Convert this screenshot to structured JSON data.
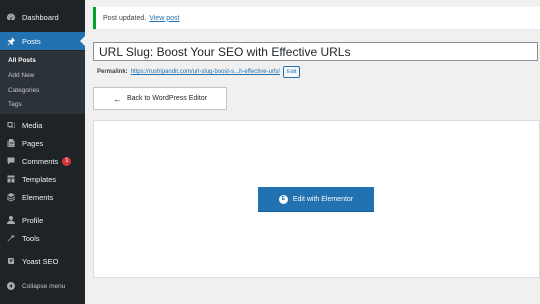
{
  "sidebar": {
    "items": [
      {
        "label": "Dashboard",
        "icon": "dashboard-icon"
      },
      {
        "label": "Posts",
        "icon": "pin-icon"
      },
      {
        "label": "Media",
        "icon": "media-icon"
      },
      {
        "label": "Pages",
        "icon": "pages-icon"
      },
      {
        "label": "Comments",
        "icon": "comments-icon",
        "badge": "1"
      },
      {
        "label": "Templates",
        "icon": "templates-icon"
      },
      {
        "label": "Elements",
        "icon": "elements-icon"
      },
      {
        "label": "Profile",
        "icon": "profile-icon"
      },
      {
        "label": "Tools",
        "icon": "tools-icon"
      },
      {
        "label": "Yoast SEO",
        "icon": "yoast-icon"
      },
      {
        "label": "Collapse menu",
        "icon": "collapse-icon"
      }
    ],
    "submenu": [
      "All Posts",
      "Add New",
      "Categories",
      "Tags"
    ]
  },
  "notice": {
    "text": "Post updated.",
    "link": "View post"
  },
  "post": {
    "title": "URL Slug: Boost Your SEO with Effective URLs"
  },
  "permalink": {
    "label": "Permalink:",
    "url": "https://rushipandit.com/url-slug-boost-s...h-effective-urls/",
    "edit": "Edit"
  },
  "back_button": {
    "label": "Back to WordPress Editor"
  },
  "elementor_button": {
    "label": "Edit with Elementor",
    "icon_glyph": "E"
  },
  "colors": {
    "sidebar_bg": "#1d2327",
    "accent": "#2271b1",
    "success": "#00a32a",
    "badge": "#d63638"
  }
}
